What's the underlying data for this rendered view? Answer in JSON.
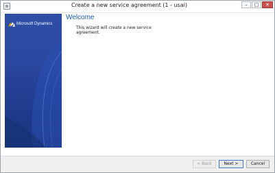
{
  "window": {
    "title": "Create a new service agreement (1 - usai)",
    "controls": {
      "minimize": "–",
      "maximize": "□",
      "close": "✕"
    }
  },
  "banner": {
    "logo_text": "Microsoft Dynamics"
  },
  "content": {
    "heading": "Welcome",
    "description": "This wizard will create a new service agreement."
  },
  "buttons": {
    "back": "< Back",
    "next": "Next >",
    "cancel": "Cancel"
  },
  "colors": {
    "heading": "#1e5ba8",
    "banner": "#2b48a0",
    "close_button": "#c75050"
  }
}
